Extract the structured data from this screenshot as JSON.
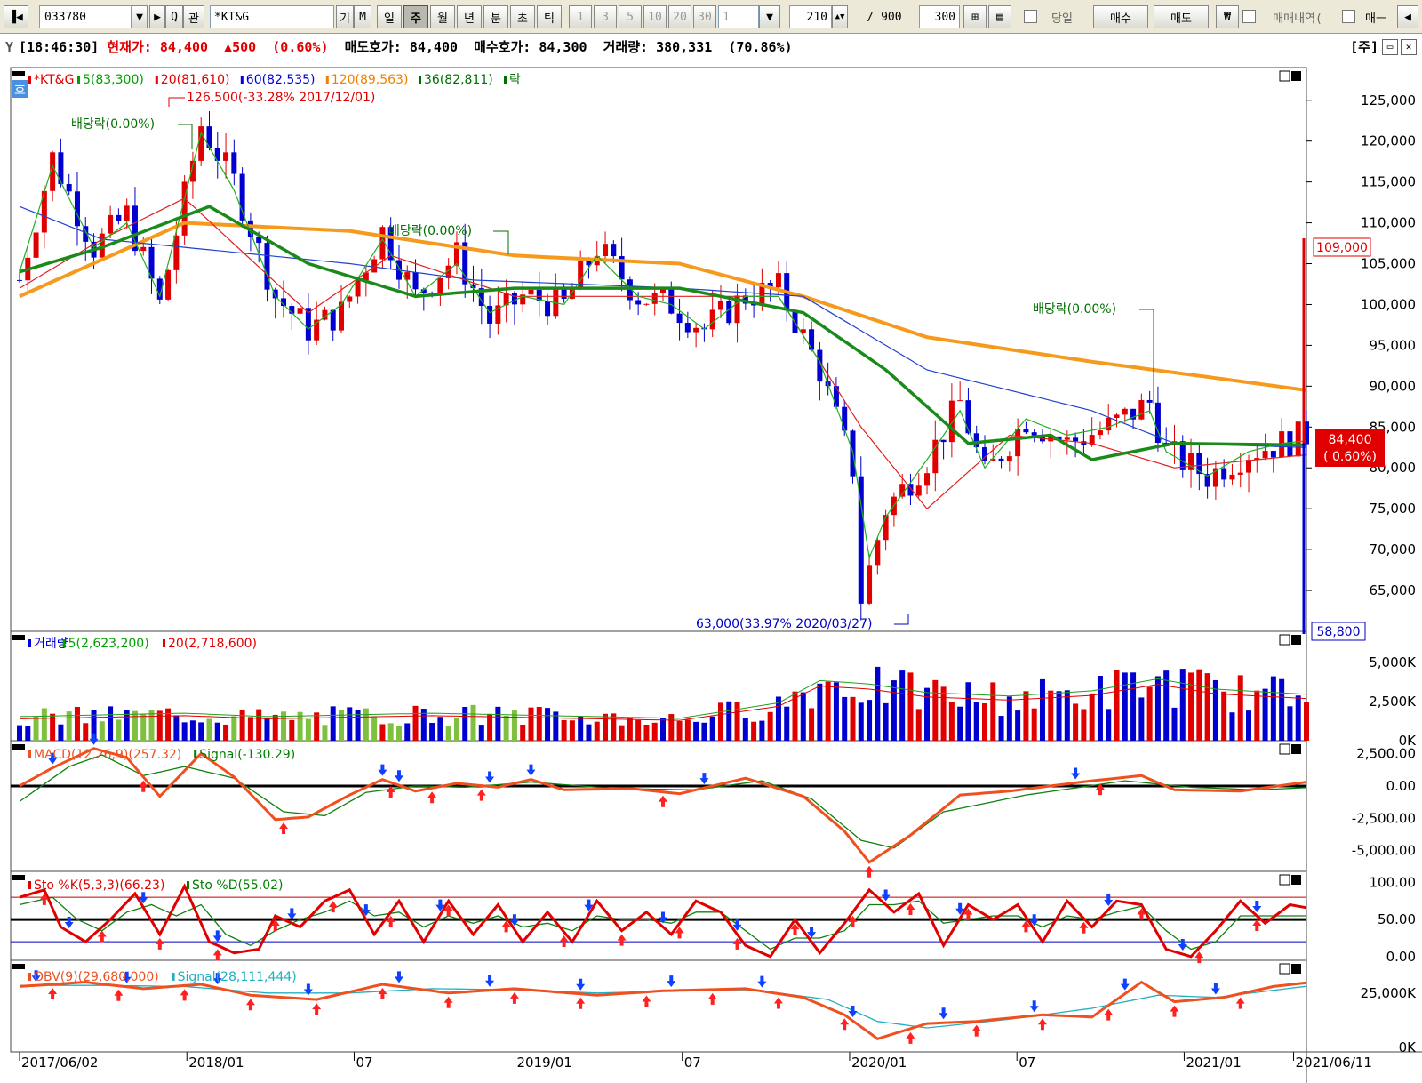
{
  "toolbar": {
    "code": "033780",
    "name": "*KT&G",
    "gi": "기",
    "m": "M",
    "search": "Q",
    "gwan": "관",
    "periods": [
      "일",
      "주",
      "월",
      "년",
      "분",
      "초",
      "틱"
    ],
    "active_period": "주",
    "intervals": [
      "1",
      "3",
      "5",
      "10",
      "20",
      "30"
    ],
    "interval_select": "1",
    "count": "210",
    "total": "/ 900",
    "visible": "300",
    "today_label": "당일",
    "buy": "매수",
    "sell": "매도",
    "won": "₩",
    "trade_history": "매매내역(",
    "maebu": "매ㅡ"
  },
  "info": {
    "time": "[18:46:30]",
    "price_label": "현재가:",
    "price": "84,400",
    "change": "▲500",
    "pct": "(0.60%)",
    "ask_label": "매도호가:",
    "ask": "84,400",
    "bid_label": "매수호가:",
    "bid": "84,300",
    "vol_label": "거래량:",
    "vol": "380,331",
    "vol_pct": "(70.86%)",
    "unit": "[주]"
  },
  "legends": {
    "price": [
      {
        "text": "*KT&G",
        "color": "#e00000"
      },
      {
        "text": "5(83,300)",
        "color": "#00a000"
      },
      {
        "text": "20(81,610)",
        "color": "#e00000"
      },
      {
        "text": "60(82,535)",
        "color": "#0000e0"
      },
      {
        "text": "120(89,563)",
        "color": "#f08000"
      },
      {
        "text": "36(82,811)",
        "color": "#007000"
      },
      {
        "text": "락",
        "color": "#007000"
      }
    ],
    "volume": [
      {
        "text": "거래량",
        "color": "#0000e0"
      },
      {
        "text": "5(2,623,200)",
        "color": "#00a000"
      },
      {
        "text": "20(2,718,600)",
        "color": "#e00000"
      }
    ],
    "macd": [
      {
        "text": "MACD(12,26,9)(257.32)",
        "color": "#f05020"
      },
      {
        "text": "Signal(-130.29)",
        "color": "#008000"
      }
    ],
    "sto": [
      {
        "text": "Sto %K(5,3,3)(66.23)",
        "color": "#e00000"
      },
      {
        "text": "Sto %D(55.02)",
        "color": "#008000"
      }
    ],
    "obv": [
      {
        "text": "OBV(9)(29,680,000)",
        "color": "#f05020"
      },
      {
        "text": "Signal(28,111,444)",
        "color": "#20b0c0"
      }
    ]
  },
  "annotations": {
    "high": "126,500(-33.28% 2017/12/01)",
    "low": "63,000(33.97% 2020/03/27)",
    "div1": "배당락(0.00%)",
    "div2": "배당락(0.00%)",
    "div3": "배당락(0.00%)",
    "side_tag": "호"
  },
  "axis": {
    "price_ticks": [
      "125,000",
      "120,000",
      "115,000",
      "110,000",
      "105,000",
      "100,000",
      "95,000",
      "90,000",
      "85,000",
      "80,000",
      "75,000",
      "70,000",
      "65,000"
    ],
    "vol_ticks": [
      "5,000K",
      "2,500K",
      "0K"
    ],
    "macd_ticks": [
      "2,500.00",
      "0.00",
      "-2,500.00",
      "-5,000.00"
    ],
    "sto_ticks": [
      "100.00",
      "50.00",
      "0.00"
    ],
    "obv_ticks": [
      "25,000K",
      "0K"
    ],
    "dates": [
      "2017/06/02",
      "2018/01",
      "07",
      "2019/01",
      "07",
      "2020/01",
      "07",
      "2021/01",
      "2021/06/11"
    ],
    "max_tag": "109,000",
    "min_tag": "58,800",
    "cur_tag": "84,400",
    "cur_pct": "( 0.60%)"
  },
  "chart_data": {
    "type": "candlestick",
    "interval": "weekly",
    "ylim": [
      60000,
      129000
    ],
    "close_path": [
      [
        0,
        103
      ],
      [
        4,
        118
      ],
      [
        9,
        107
      ],
      [
        13,
        111
      ],
      [
        17,
        100
      ],
      [
        22,
        122
      ],
      [
        26,
        115
      ],
      [
        31,
        101
      ],
      [
        35,
        97
      ],
      [
        39,
        99
      ],
      [
        44,
        109
      ],
      [
        48,
        101
      ],
      [
        53,
        106
      ],
      [
        57,
        98
      ],
      [
        61,
        101
      ],
      [
        66,
        100
      ],
      [
        70,
        107
      ],
      [
        75,
        101
      ],
      [
        79,
        100
      ],
      [
        83,
        97
      ],
      [
        88,
        101
      ],
      [
        92,
        102
      ],
      [
        97,
        92
      ],
      [
        101,
        80
      ],
      [
        102,
        64
      ],
      [
        105,
        75
      ],
      [
        110,
        81
      ],
      [
        114,
        88
      ],
      [
        117,
        79
      ],
      [
        122,
        86
      ],
      [
        127,
        83
      ],
      [
        132,
        85
      ],
      [
        137,
        88
      ],
      [
        139,
        82
      ],
      [
        144,
        79
      ],
      [
        149,
        82
      ],
      [
        153,
        83
      ],
      [
        156,
        84
      ]
    ],
    "ma120": [
      [
        0,
        101
      ],
      [
        20,
        110
      ],
      [
        40,
        109
      ],
      [
        60,
        106
      ],
      [
        80,
        105
      ],
      [
        95,
        101
      ],
      [
        110,
        96
      ],
      [
        130,
        93
      ],
      [
        145,
        91
      ],
      [
        156,
        89.5
      ]
    ],
    "ma60": [
      [
        0,
        112
      ],
      [
        10,
        108
      ],
      [
        20,
        107
      ],
      [
        40,
        105
      ],
      [
        55,
        103
      ],
      [
        80,
        102
      ],
      [
        95,
        101
      ],
      [
        110,
        92
      ],
      [
        130,
        87
      ],
      [
        140,
        83
      ],
      [
        156,
        82.5
      ]
    ],
    "ma36": [
      [
        0,
        104
      ],
      [
        10,
        107
      ],
      [
        23,
        112
      ],
      [
        35,
        105
      ],
      [
        48,
        101
      ],
      [
        60,
        102
      ],
      [
        80,
        102
      ],
      [
        95,
        99
      ],
      [
        105,
        92
      ],
      [
        115,
        83
      ],
      [
        125,
        84
      ],
      [
        130,
        81
      ],
      [
        140,
        83
      ],
      [
        156,
        82.8
      ]
    ],
    "ma20": [
      [
        0,
        102
      ],
      [
        10,
        108
      ],
      [
        20,
        113
      ],
      [
        35,
        99
      ],
      [
        45,
        106
      ],
      [
        60,
        101
      ],
      [
        80,
        101
      ],
      [
        92,
        101
      ],
      [
        102,
        85
      ],
      [
        110,
        75
      ],
      [
        120,
        84
      ],
      [
        130,
        83
      ],
      [
        140,
        80
      ],
      [
        156,
        81.6
      ]
    ],
    "ma5": [
      [
        0,
        104
      ],
      [
        4,
        117
      ],
      [
        9,
        107
      ],
      [
        13,
        110
      ],
      [
        17,
        101
      ],
      [
        22,
        121
      ],
      [
        26,
        114
      ],
      [
        31,
        101
      ],
      [
        35,
        97
      ],
      [
        39,
        100
      ],
      [
        44,
        108
      ],
      [
        48,
        101
      ],
      [
        53,
        105
      ],
      [
        57,
        99
      ],
      [
        61,
        101
      ],
      [
        66,
        100
      ],
      [
        70,
        106
      ],
      [
        75,
        101
      ],
      [
        79,
        100
      ],
      [
        83,
        97
      ],
      [
        88,
        101
      ],
      [
        92,
        101
      ],
      [
        97,
        93
      ],
      [
        101,
        82
      ],
      [
        103,
        69
      ],
      [
        105,
        74
      ],
      [
        110,
        81
      ],
      [
        114,
        87
      ],
      [
        117,
        80
      ],
      [
        122,
        86
      ],
      [
        127,
        84
      ],
      [
        132,
        85
      ],
      [
        137,
        87
      ],
      [
        139,
        82
      ],
      [
        144,
        79
      ],
      [
        149,
        82
      ],
      [
        153,
        83
      ],
      [
        156,
        83.3
      ]
    ],
    "volume_path": [
      [
        0,
        1400
      ],
      [
        10,
        1500
      ],
      [
        20,
        1600
      ],
      [
        30,
        1400
      ],
      [
        40,
        1500
      ],
      [
        50,
        1600
      ],
      [
        60,
        1500
      ],
      [
        70,
        1400
      ],
      [
        80,
        1300
      ],
      [
        92,
        2200
      ],
      [
        97,
        3500
      ],
      [
        103,
        3300
      ],
      [
        110,
        2800
      ],
      [
        120,
        2600
      ],
      [
        130,
        2900
      ],
      [
        138,
        3600
      ],
      [
        145,
        3000
      ],
      [
        156,
        2700
      ]
    ],
    "macd_path": [
      [
        0,
        0
      ],
      [
        4,
        1400
      ],
      [
        9,
        2900
      ],
      [
        13,
        2200
      ],
      [
        17,
        -800
      ],
      [
        22,
        2500
      ],
      [
        26,
        700
      ],
      [
        31,
        -2600
      ],
      [
        35,
        -2400
      ],
      [
        40,
        -700
      ],
      [
        44,
        500
      ],
      [
        48,
        -400
      ],
      [
        53,
        200
      ],
      [
        58,
        -100
      ],
      [
        62,
        500
      ],
      [
        66,
        -300
      ],
      [
        74,
        -200
      ],
      [
        80,
        -600
      ],
      [
        88,
        600
      ],
      [
        95,
        -800
      ],
      [
        100,
        -3500
      ],
      [
        103,
        -5900
      ],
      [
        108,
        -3800
      ],
      [
        114,
        -700
      ],
      [
        120,
        -400
      ],
      [
        130,
        400
      ],
      [
        136,
        800
      ],
      [
        140,
        -300
      ],
      [
        148,
        -400
      ],
      [
        156,
        300
      ]
    ],
    "signal_path": [
      [
        0,
        -1200
      ],
      [
        6,
        1500
      ],
      [
        10,
        2400
      ],
      [
        15,
        800
      ],
      [
        20,
        1500
      ],
      [
        26,
        600
      ],
      [
        32,
        -2000
      ],
      [
        37,
        -2300
      ],
      [
        42,
        -500
      ],
      [
        48,
        0
      ],
      [
        54,
        -100
      ],
      [
        62,
        300
      ],
      [
        72,
        -200
      ],
      [
        82,
        -300
      ],
      [
        90,
        400
      ],
      [
        96,
        -1000
      ],
      [
        102,
        -4200
      ],
      [
        106,
        -4800
      ],
      [
        112,
        -2000
      ],
      [
        122,
        -700
      ],
      [
        134,
        400
      ],
      [
        142,
        -100
      ],
      [
        150,
        -300
      ],
      [
        156,
        -130
      ]
    ],
    "stoch_k_path": [
      [
        0,
        80
      ],
      [
        3,
        90
      ],
      [
        5,
        40
      ],
      [
        8,
        20
      ],
      [
        11,
        50
      ],
      [
        14,
        85
      ],
      [
        17,
        30
      ],
      [
        20,
        95
      ],
      [
        23,
        20
      ],
      [
        26,
        5
      ],
      [
        29,
        10
      ],
      [
        31,
        55
      ],
      [
        34,
        40
      ],
      [
        37,
        75
      ],
      [
        40,
        90
      ],
      [
        43,
        30
      ],
      [
        46,
        75
      ],
      [
        49,
        20
      ],
      [
        52,
        75
      ],
      [
        55,
        30
      ],
      [
        58,
        70
      ],
      [
        61,
        20
      ],
      [
        64,
        60
      ],
      [
        67,
        20
      ],
      [
        70,
        75
      ],
      [
        73,
        35
      ],
      [
        76,
        60
      ],
      [
        79,
        30
      ],
      [
        82,
        75
      ],
      [
        85,
        60
      ],
      [
        88,
        15
      ],
      [
        91,
        0
      ],
      [
        94,
        50
      ],
      [
        97,
        5
      ],
      [
        100,
        45
      ],
      [
        103,
        90
      ],
      [
        106,
        60
      ],
      [
        109,
        85
      ],
      [
        112,
        15
      ],
      [
        115,
        70
      ],
      [
        118,
        50
      ],
      [
        121,
        70
      ],
      [
        124,
        20
      ],
      [
        127,
        75
      ],
      [
        130,
        40
      ],
      [
        133,
        75
      ],
      [
        136,
        70
      ],
      [
        139,
        10
      ],
      [
        142,
        0
      ],
      [
        145,
        35
      ],
      [
        148,
        75
      ],
      [
        151,
        45
      ],
      [
        154,
        70
      ],
      [
        156,
        66
      ]
    ],
    "stoch_d_path": [
      [
        0,
        70
      ],
      [
        4,
        80
      ],
      [
        7,
        50
      ],
      [
        10,
        35
      ],
      [
        13,
        60
      ],
      [
        16,
        70
      ],
      [
        19,
        55
      ],
      [
        22,
        70
      ],
      [
        25,
        30
      ],
      [
        28,
        15
      ],
      [
        31,
        35
      ],
      [
        34,
        50
      ],
      [
        37,
        60
      ],
      [
        40,
        75
      ],
      [
        43,
        55
      ],
      [
        46,
        60
      ],
      [
        49,
        40
      ],
      [
        52,
        55
      ],
      [
        55,
        45
      ],
      [
        58,
        55
      ],
      [
        61,
        40
      ],
      [
        64,
        45
      ],
      [
        67,
        35
      ],
      [
        70,
        55
      ],
      [
        73,
        50
      ],
      [
        76,
        50
      ],
      [
        79,
        45
      ],
      [
        82,
        60
      ],
      [
        85,
        60
      ],
      [
        88,
        35
      ],
      [
        91,
        10
      ],
      [
        94,
        25
      ],
      [
        97,
        25
      ],
      [
        100,
        35
      ],
      [
        103,
        70
      ],
      [
        106,
        70
      ],
      [
        109,
        75
      ],
      [
        112,
        45
      ],
      [
        115,
        50
      ],
      [
        118,
        55
      ],
      [
        121,
        55
      ],
      [
        124,
        40
      ],
      [
        127,
        55
      ],
      [
        130,
        50
      ],
      [
        133,
        60
      ],
      [
        136,
        68
      ],
      [
        139,
        35
      ],
      [
        142,
        10
      ],
      [
        145,
        20
      ],
      [
        148,
        55
      ],
      [
        151,
        55
      ],
      [
        154,
        55
      ],
      [
        156,
        55
      ]
    ],
    "obv_path": [
      [
        0,
        28000
      ],
      [
        8,
        30000
      ],
      [
        15,
        27000
      ],
      [
        22,
        29000
      ],
      [
        28,
        24000
      ],
      [
        36,
        22000
      ],
      [
        44,
        29000
      ],
      [
        52,
        25000
      ],
      [
        60,
        27000
      ],
      [
        70,
        24000
      ],
      [
        78,
        26000
      ],
      [
        88,
        27000
      ],
      [
        95,
        23000
      ],
      [
        100,
        15000
      ],
      [
        104,
        4000
      ],
      [
        110,
        11000
      ],
      [
        116,
        12000
      ],
      [
        124,
        15000
      ],
      [
        130,
        14000
      ],
      [
        136,
        30000
      ],
      [
        140,
        21000
      ],
      [
        146,
        23000
      ],
      [
        152,
        28000
      ],
      [
        156,
        29680
      ]
    ],
    "obv_signal_path": [
      [
        0,
        28500
      ],
      [
        10,
        28500
      ],
      [
        20,
        28000
      ],
      [
        30,
        25000
      ],
      [
        40,
        25000
      ],
      [
        50,
        27000
      ],
      [
        60,
        26500
      ],
      [
        70,
        25000
      ],
      [
        80,
        26000
      ],
      [
        90,
        26000
      ],
      [
        98,
        22000
      ],
      [
        104,
        12000
      ],
      [
        110,
        9000
      ],
      [
        120,
        13000
      ],
      [
        130,
        18000
      ],
      [
        138,
        24000
      ],
      [
        145,
        23000
      ],
      [
        156,
        28111
      ]
    ]
  }
}
